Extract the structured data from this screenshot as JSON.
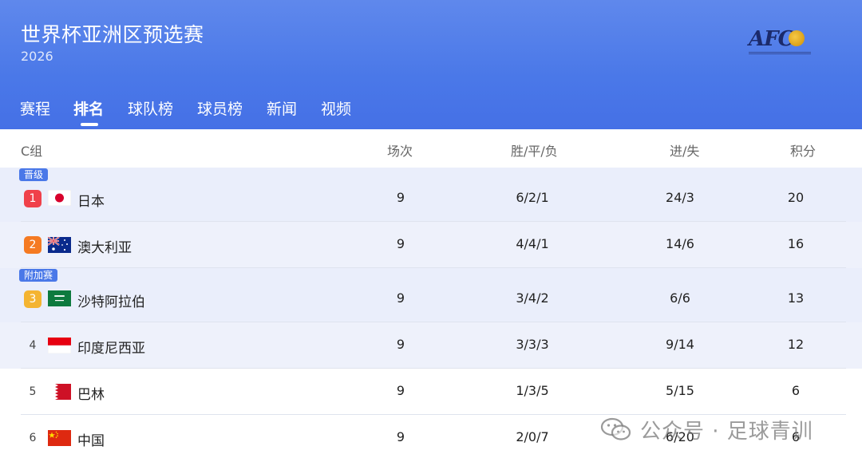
{
  "header": {
    "title": "世界杯亚洲区预选赛",
    "year": "2026",
    "logo_text": "AFC",
    "bg_color": "#4a78e8"
  },
  "tabs": [
    {
      "label": "赛程",
      "active": false
    },
    {
      "label": "排名",
      "active": true
    },
    {
      "label": "球队榜",
      "active": false
    },
    {
      "label": "球员榜",
      "active": false
    },
    {
      "label": "新闻",
      "active": false
    },
    {
      "label": "视频",
      "active": false
    }
  ],
  "table": {
    "group": "C组",
    "columns": {
      "played": "场次",
      "wdl": "胜/平/负",
      "goals": "进/失",
      "points": "积分"
    },
    "rows": [
      {
        "rank": "1",
        "tag": "晋级",
        "team": "日本",
        "flag": "japan-flag",
        "played": "9",
        "wdl": "6/2/1",
        "goals": "24/3",
        "points": "20",
        "rank_color": "#f0414a"
      },
      {
        "rank": "2",
        "tag": "",
        "team": "澳大利亚",
        "flag": "australia-flag",
        "played": "9",
        "wdl": "4/4/1",
        "goals": "14/6",
        "points": "16",
        "rank_color": "#f57a22"
      },
      {
        "rank": "3",
        "tag": "附加赛",
        "team": "沙特阿拉伯",
        "flag": "saudi-arabia-flag",
        "played": "9",
        "wdl": "3/4/2",
        "goals": "6/6",
        "points": "13",
        "rank_color": "#f4b431"
      },
      {
        "rank": "4",
        "tag": "",
        "team": "印度尼西亚",
        "flag": "indonesia-flag",
        "played": "9",
        "wdl": "3/3/3",
        "goals": "9/14",
        "points": "12",
        "rank_color": ""
      },
      {
        "rank": "5",
        "tag": "",
        "team": "巴林",
        "flag": "bahrain-flag",
        "played": "9",
        "wdl": "1/3/5",
        "goals": "5/15",
        "points": "6",
        "rank_color": ""
      },
      {
        "rank": "6",
        "tag": "",
        "team": "中国",
        "flag": "china-flag",
        "played": "9",
        "wdl": "2/0/7",
        "goals": "6/20",
        "points": "6",
        "rank_color": ""
      }
    ]
  },
  "watermark": {
    "text": "公众号 · 足球青训",
    "icon": "wechat-icon"
  }
}
